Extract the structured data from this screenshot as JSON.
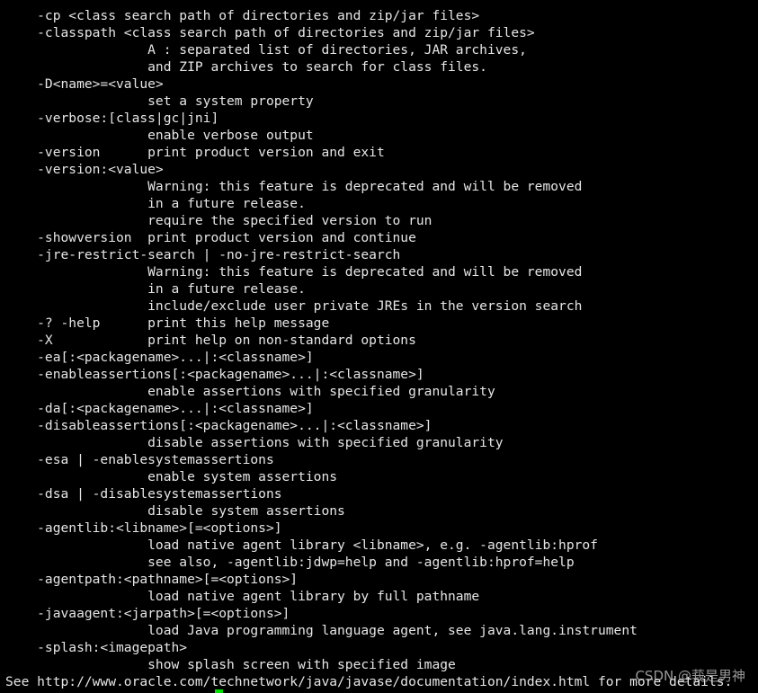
{
  "terminal": {
    "lines": [
      "    -cp <class search path of directories and zip/jar files>",
      "    -classpath <class search path of directories and zip/jar files>",
      "                  A : separated list of directories, JAR archives,",
      "                  and ZIP archives to search for class files.",
      "    -D<name>=<value>",
      "                  set a system property",
      "    -verbose:[class|gc|jni]",
      "                  enable verbose output",
      "    -version      print product version and exit",
      "    -version:<value>",
      "                  Warning: this feature is deprecated and will be removed",
      "                  in a future release.",
      "                  require the specified version to run",
      "    -showversion  print product version and continue",
      "    -jre-restrict-search | -no-jre-restrict-search",
      "                  Warning: this feature is deprecated and will be removed",
      "                  in a future release.",
      "                  include/exclude user private JREs in the version search",
      "    -? -help      print this help message",
      "    -X            print help on non-standard options",
      "    -ea[:<packagename>...|:<classname>]",
      "    -enableassertions[:<packagename>...|:<classname>]",
      "                  enable assertions with specified granularity",
      "    -da[:<packagename>...|:<classname>]",
      "    -disableassertions[:<packagename>...|:<classname>]",
      "                  disable assertions with specified granularity",
      "    -esa | -enablesystemassertions",
      "                  enable system assertions",
      "    -dsa | -disablesystemassertions",
      "                  disable system assertions",
      "    -agentlib:<libname>[=<options>]",
      "                  load native agent library <libname>, e.g. -agentlib:hprof",
      "                  see also, -agentlib:jdwp=help and -agentlib:hprof=help",
      "    -agentpath:<pathname>[=<options>]",
      "                  load native agent library by full pathname",
      "    -javaagent:<jarpath>[=<options>]",
      "                  load Java programming language agent, see java.lang.instrument",
      "    -splash:<imagepath>",
      "                  show splash screen with specified image",
      "See http://www.oracle.com/technetwork/java/javase/documentation/index.html for more details."
    ],
    "cursor_color": "#00e000"
  },
  "watermark": "CSDN @莪是男神"
}
